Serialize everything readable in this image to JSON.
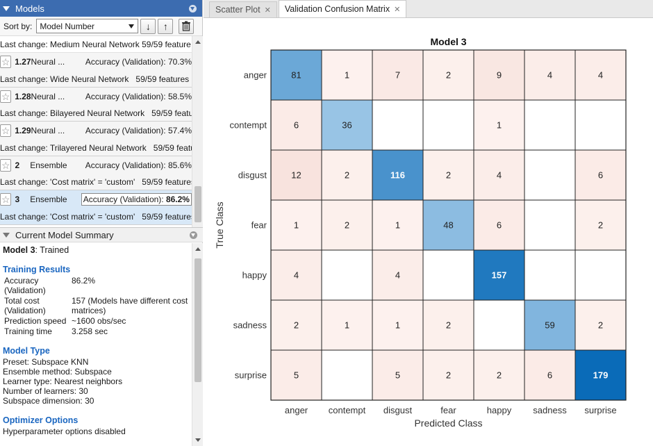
{
  "models_panel": {
    "title": "Models",
    "sort_label": "Sort by:",
    "sort_value": "Model Number",
    "truncated_top": "Last change: Medium Neural Network  59/59 feature",
    "items": [
      {
        "num": "1.27",
        "type": "Neural ...",
        "accuracy": "Accuracy (Validation): 70.3%",
        "change": "Last change: Wide Neural Network",
        "features": "59/59 features",
        "selected": false
      },
      {
        "num": "1.28",
        "type": "Neural ...",
        "accuracy": "Accuracy (Validation): 58.5%",
        "change": "Last change: Bilayered Neural Network",
        "features": "59/59 featu",
        "selected": false
      },
      {
        "num": "1.29",
        "type": "Neural ...",
        "accuracy": "Accuracy (Validation): 57.4%",
        "change": "Last change: Trilayered Neural Network",
        "features": "59/59 featu",
        "selected": false
      },
      {
        "num": "2",
        "type": "Ensemble",
        "accuracy": "Accuracy (Validation): 85.6%",
        "change": "Last change: 'Cost matrix' = 'custom'",
        "features": "59/59 features",
        "selected": false
      },
      {
        "num": "3",
        "type": "Ensemble",
        "accuracy_label": "Accuracy (Validation): ",
        "accuracy_value": "86.2%",
        "change": "Last change: 'Cost matrix' = 'custom'",
        "features": "59/59 features",
        "selected": true
      }
    ]
  },
  "summary_panel": {
    "title": "Current Model Summary",
    "model_name": "Model 3",
    "model_status": ": Trained",
    "training_results_heading": "Training Results",
    "results": [
      {
        "key": "Accuracy (Validation)",
        "value": "86.2%"
      },
      {
        "key": "Total cost (Validation)",
        "value": "157 (Models have different cost matrices)"
      },
      {
        "key": "Prediction speed",
        "value": "~1600 obs/sec"
      },
      {
        "key": "Training time",
        "value": "3.258 sec"
      }
    ],
    "model_type_heading": "Model Type",
    "model_type_lines": [
      "Preset: Subspace KNN",
      "Ensemble method: Subspace",
      "Learner type: Nearest neighbors",
      "Number of learners: 30",
      "Subspace dimension: 30"
    ],
    "optimizer_heading": "Optimizer Options",
    "optimizer_lines": [
      "Hyperparameter options disabled"
    ]
  },
  "tabs": [
    {
      "label": "Scatter Plot",
      "active": false
    },
    {
      "label": "Validation Confusion Matrix",
      "active": true
    }
  ],
  "chart_data": {
    "type": "heatmap",
    "title": "Model 3",
    "xlabel": "Predicted Class",
    "ylabel": "True Class",
    "classes": [
      "anger",
      "contempt",
      "disgust",
      "fear",
      "happy",
      "sadness",
      "surprise"
    ],
    "matrix": [
      [
        81,
        1,
        7,
        2,
        9,
        4,
        4
      ],
      [
        6,
        36,
        null,
        null,
        1,
        null,
        null
      ],
      [
        12,
        2,
        116,
        2,
        4,
        null,
        6
      ],
      [
        1,
        2,
        1,
        48,
        6,
        null,
        2
      ],
      [
        4,
        null,
        4,
        null,
        157,
        null,
        null
      ],
      [
        2,
        1,
        1,
        2,
        null,
        59,
        2
      ],
      [
        5,
        null,
        5,
        2,
        2,
        6,
        179
      ]
    ],
    "colors": {
      "diag_low": "#bcdaf0",
      "diag_high": "#0a6bb8",
      "offdiag_low": "#fdf2ef",
      "offdiag_high": "#f8e3de",
      "empty": "#ffffff"
    }
  }
}
